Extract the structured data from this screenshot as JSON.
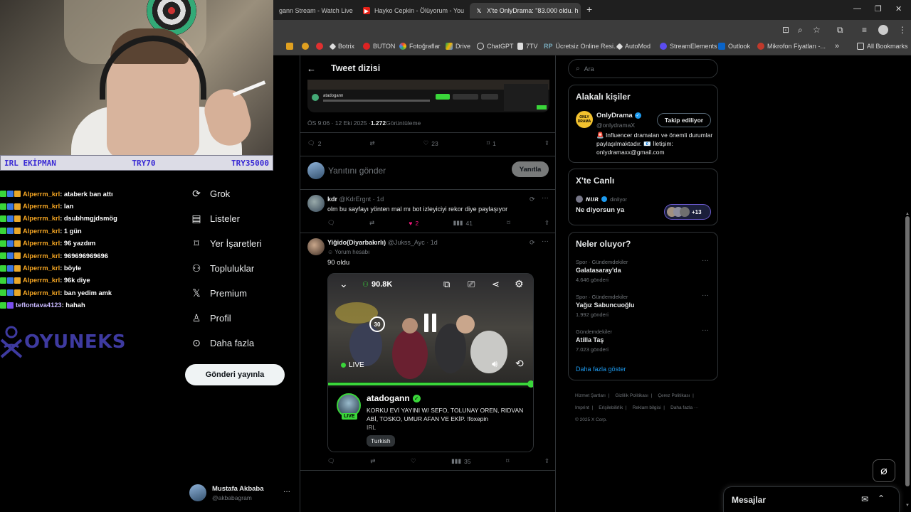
{
  "browser": {
    "tabs": [
      {
        "label": "gann Stream - Watch Live",
        "active": false
      },
      {
        "label": "Hayko Cepkin - Ölüyorum - You",
        "active": false
      },
      {
        "label": "X'te OnlyDrama: \"83.000 oldu. h",
        "active": true
      }
    ],
    "new_tab": "+",
    "window_controls": [
      "—",
      "❐",
      "✕"
    ],
    "bookmarks": [
      "Botrix",
      "BUTON",
      "Fotoğraflar",
      "Drive",
      "ChatGPT",
      "7TV",
      "Ücretsiz Online Resi...",
      "AutoMod",
      "StreamElements",
      "Outlook",
      "Mikrofon Fiyatları -..."
    ],
    "bookmarks_more": "»",
    "all_bookmarks": "All Bookmarks"
  },
  "overlay": {
    "irl_left": "IRL EKİPMAN",
    "irl_mid": "TRY70",
    "irl_right": "TRY35000",
    "chat": [
      {
        "user": "Alperrm_krl",
        "msg": ": ataberk ban attı"
      },
      {
        "user": "Alperrm_krl",
        "msg": ": lan"
      },
      {
        "user": "Alperrm_krl",
        "msg": ": dsubhmgjdsmög"
      },
      {
        "user": "Alperrm_krl",
        "msg": ": 1 gün"
      },
      {
        "user": "Alperrm_krl",
        "msg": ": 96 yazdım"
      },
      {
        "user": "Alperrm_krl",
        "msg": ": 969696969696"
      },
      {
        "user": "Alperrm_krl",
        "msg": ": böyle"
      },
      {
        "user": "Alperrm_krl",
        "msg": ": 96k diye"
      },
      {
        "user": "Alperrm_krl",
        "msg": ": ban yedim amk"
      },
      {
        "user": "teflontava4123",
        "msg": ": hahah"
      }
    ],
    "brand": "OYUNEKS"
  },
  "nav": {
    "items": [
      "Grok",
      "Listeler",
      "Yer İşaretleri",
      "Topluluklar",
      "Premium",
      "Profil",
      "Daha fazla"
    ],
    "post_button": "Gönderi yayınla",
    "account_name": "Mustafa Akbaba",
    "account_handle": "@akbabagram",
    "account_more": "···"
  },
  "main": {
    "header_title": "Tweet dizisi",
    "embed_user": "atadogann",
    "tweet_meta": "ÖS 9:06 · 12 Eki 2025 · ",
    "tweet_views": "1.272",
    "tweet_views_label": " Görüntüleme",
    "tweet_actions": {
      "replies": "2",
      "likes": "23",
      "bookmarks": "1"
    },
    "reply_placeholder": "Yanıtını gönder",
    "reply_button": "Yanıtla",
    "replies": [
      {
        "name": "kdr",
        "handle": "@KdrErgnt · 1d",
        "text": "olm bu sayfayı yönten mal mı bot izleyiciyi rekor diye paylaşıyor",
        "likes": "2",
        "views": "41"
      },
      {
        "name": "Yiğido(Diyarbakırlı)",
        "handle": "@Jukss_Ayc · 1d",
        "badge": "Yorum hesabı",
        "text": "90 oldu",
        "views": "35"
      }
    ],
    "video": {
      "viewers": "90.8K",
      "live_label": "LIVE",
      "rewind": "30",
      "streamer": "atadogann",
      "live_badge": "LIVE",
      "title": "KORKU EVİ YAYINI W/  SEFO, TOLUNAY OREN, RIDVAN ABİ, TOSKO, UMUR AFAN VE EKİP. !foxepin",
      "category": "IRL",
      "tag": "Turkish"
    }
  },
  "right": {
    "search_placeholder": "Ara",
    "related_title": "Alakalı kişiler",
    "related": {
      "name": "OnlyDrama",
      "handle": "@onlydramaX",
      "follow_label": "Takip ediliyor",
      "bio": "🚨 Influencer dramaları ve önemli durumlar paylaşılmaktadır. 📧 İletişim: onlydramaxx@gmail.com"
    },
    "live_title": "X'te Canlı",
    "live_host": "𝙉𝙐𝙍",
    "live_status": "dinliyor",
    "live_topic": "Ne diyorsun ya",
    "live_count": "+13",
    "trends_title": "Neler oluyor?",
    "trends": [
      {
        "category": "Spor · Gündemdekiler",
        "name": "Galatasaray'da",
        "count": "4.646 gönderi"
      },
      {
        "category": "Spor · Gündemdekiler",
        "name": "Yağız Sabuncuoğlu",
        "count": "1.992 gönderi"
      },
      {
        "category": "Gündemdekiler",
        "name": "Atilla Taş",
        "count": "7.023 gönderi"
      }
    ],
    "show_more": "Daha fazla göster",
    "footer": [
      "Hizmet Şartları",
      "Gizlilik Politikası",
      "Çerez Politikası",
      "Imprint",
      "Erişilebilirlik",
      "Reklam bilgisi",
      "Daha fazla ···"
    ],
    "copyright": "© 2025 X Corp.",
    "messages_label": "Mesajlar"
  },
  "colors": {
    "accent_green": "#3ad63a",
    "x_blue": "#1d9bf0",
    "chat_user": "#f5a623",
    "brand_purple": "#3e3aa0"
  }
}
